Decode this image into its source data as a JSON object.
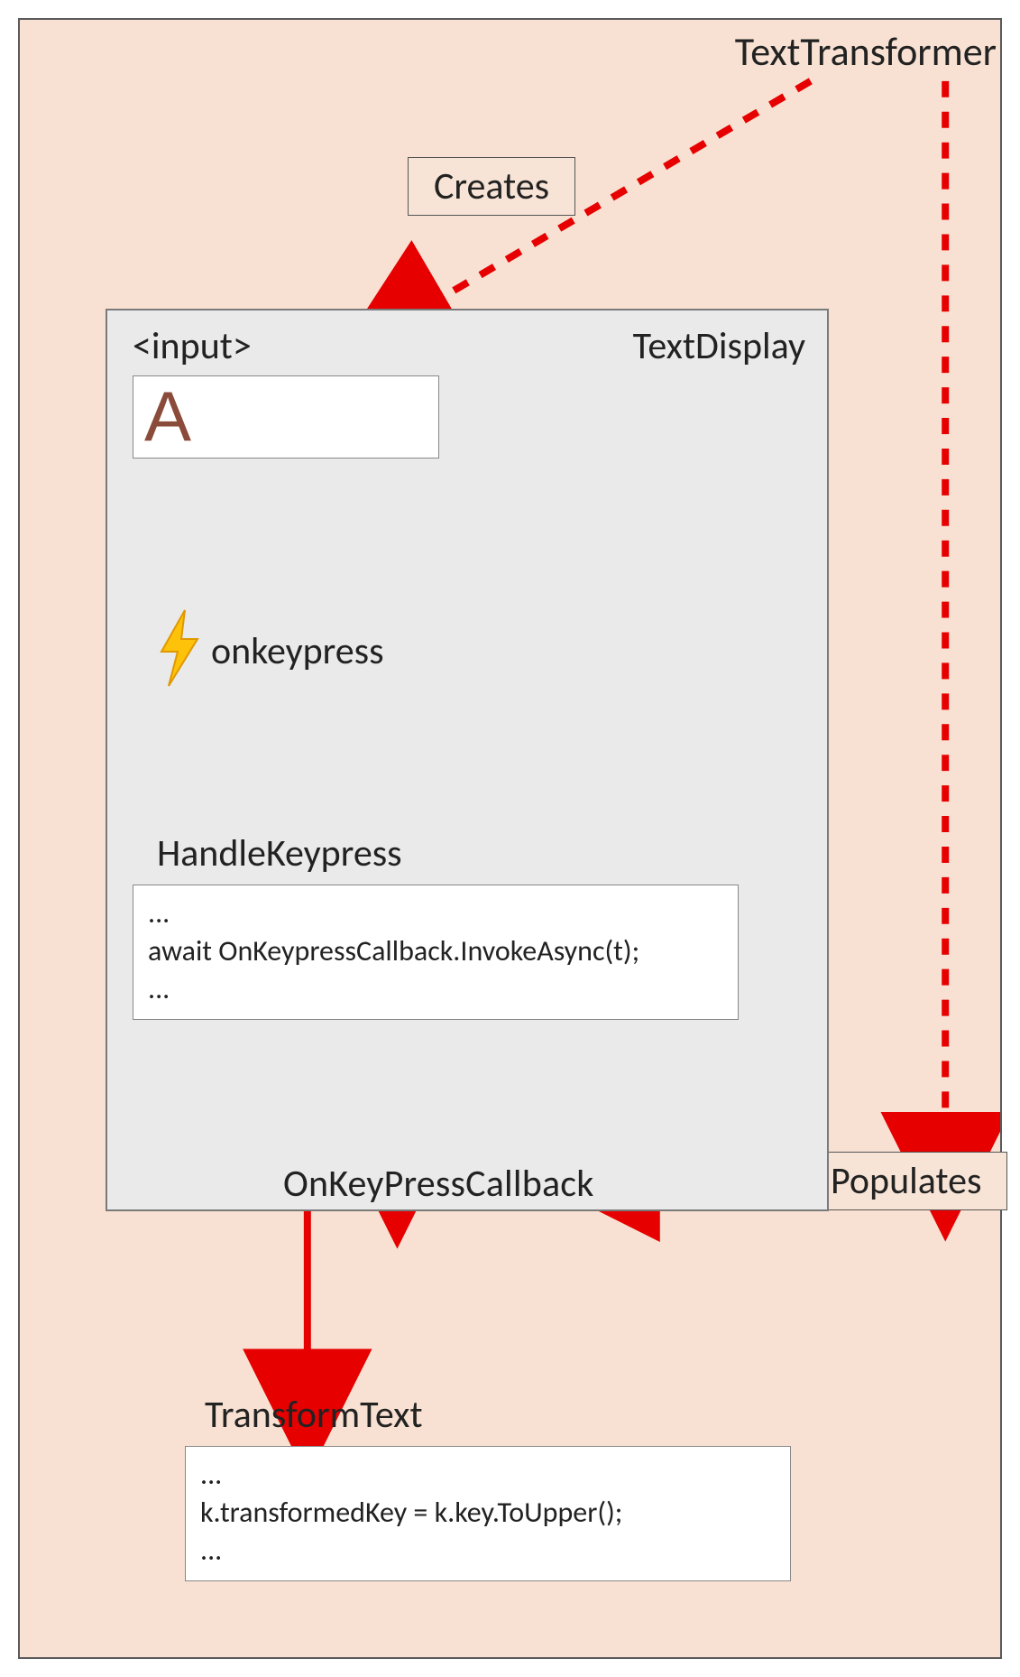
{
  "outer": {
    "title": "TextTransformer",
    "creates_label": "Creates",
    "populates_label": "Populates"
  },
  "textDisplay": {
    "title": "TextDisplay",
    "input_tag_label": "<input>",
    "input_value": "A",
    "event_label": "onkeypress",
    "handle_keypress_title": "HandleKeypress",
    "handle_keypress_code": {
      "l1": "...",
      "l2": "await OnKeypressCallback.InvokeAsync(t);",
      "l3": "..."
    },
    "callback_label": "OnKeyPressCallback"
  },
  "transform": {
    "title": "TransformText",
    "code": {
      "l1": "...",
      "l2": "k.transformedKey = k.key.ToUpper();",
      "l3": "..."
    }
  }
}
